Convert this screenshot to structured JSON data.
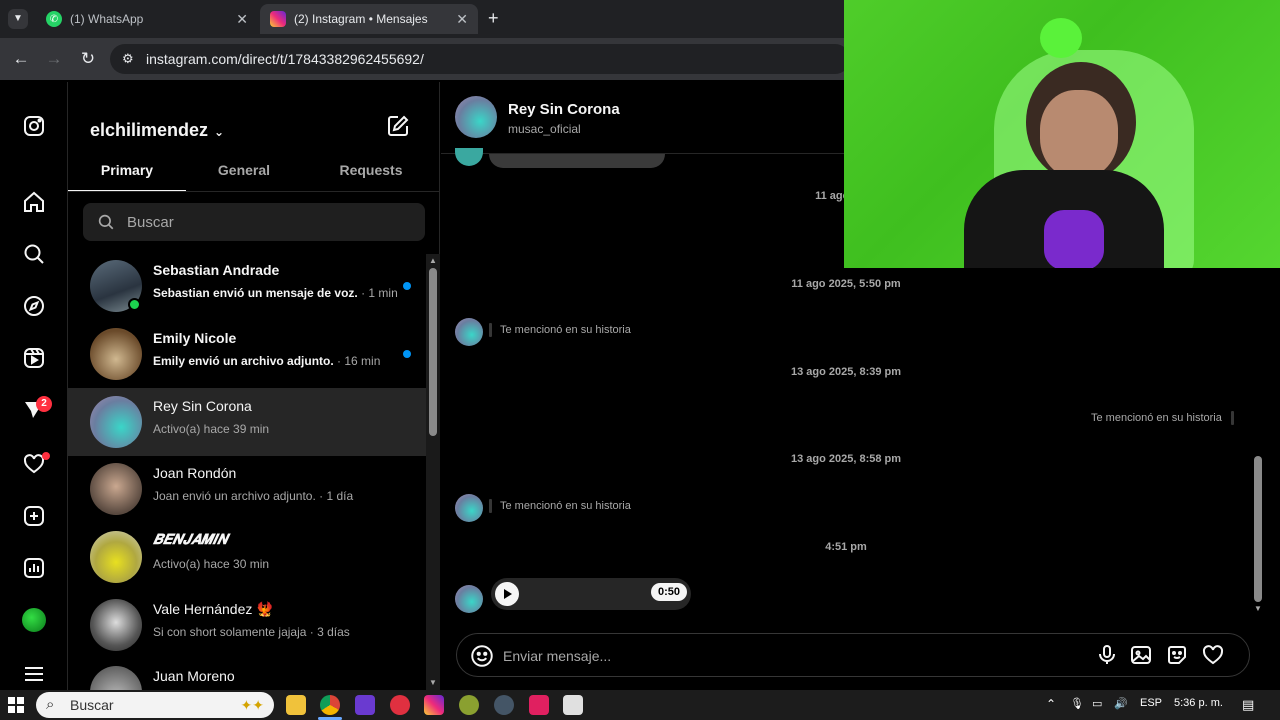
{
  "browser": {
    "tabs": [
      {
        "title": "(1) WhatsApp",
        "active": false
      },
      {
        "title": "(2) Instagram • Mensajes",
        "active": true
      }
    ],
    "url": "instagram.com/direct/t/17843382962455692/"
  },
  "sidebar": {
    "notifications_badge": "2"
  },
  "inbox": {
    "username": "elchilimendez",
    "tabs": [
      "Primary",
      "General",
      "Requests"
    ],
    "search_placeholder": "Buscar",
    "conversations": [
      {
        "name": "Sebastian Andrade",
        "preview": "Sebastian envió un mensaje de voz.",
        "time": "· 1 min",
        "unread": true
      },
      {
        "name": "Emily Nicole",
        "preview": "Emily envió un archivo adjunto.",
        "time": "· 16 min",
        "unread": true
      },
      {
        "name": "Rey Sin Corona",
        "preview": "Activo(a) hace 39 min",
        "time": "",
        "unread": false
      },
      {
        "name": "Joan Rondón",
        "preview": "Joan envió un archivo adjunto.",
        "time": "· 1 día",
        "unread": false
      },
      {
        "name": "𝑩𝑬𝑵𝑱𝑨𝑴𝑰𝑵",
        "preview": "Activo(a) hace 30 min",
        "time": "",
        "unread": false
      },
      {
        "name": "Vale Hernández 🐦‍🔥",
        "preview": "Si con short solamente jajaja",
        "time": "· 3 días",
        "unread": false
      },
      {
        "name": "Juan Moreno",
        "preview": "",
        "time": "",
        "unread": false
      }
    ]
  },
  "chat": {
    "name": "Rey Sin Corona",
    "username": "musac_oficial",
    "timestamps": [
      "11 ago 2025",
      "11 ago 2025, 5:50 pm",
      "13 ago 2025, 8:39 pm",
      "13 ago 2025, 8:58 pm",
      "4:51 pm"
    ],
    "story_mention": "Te mencionó en su historia",
    "voice_duration": "0:50",
    "composer_placeholder": "Enviar mensaje..."
  },
  "taskbar": {
    "search": "Buscar",
    "lang": "ESP",
    "clock": "5:36 p. m."
  }
}
